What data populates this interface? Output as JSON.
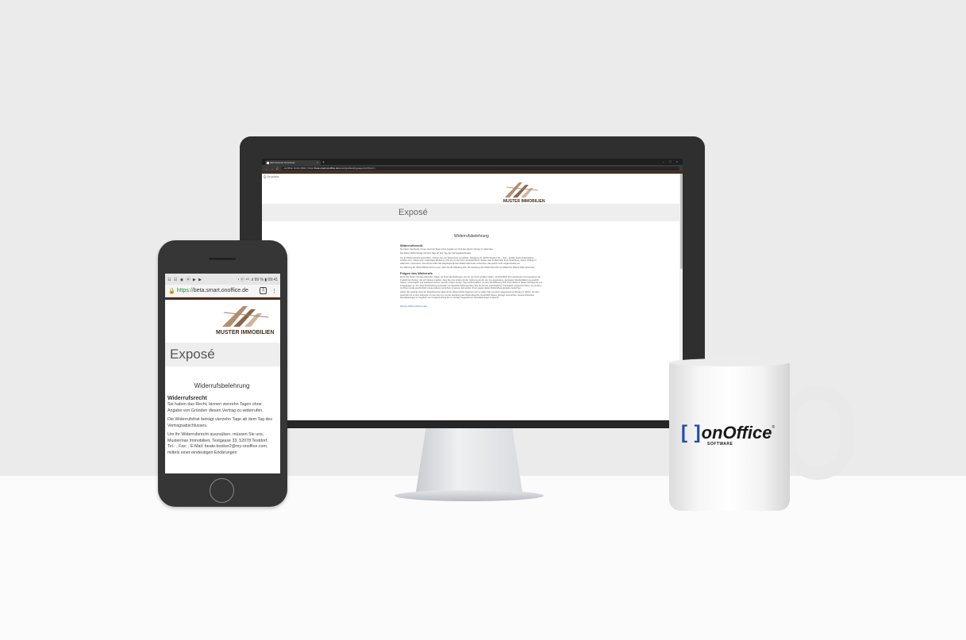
{
  "desktop": {
    "tab_title": "SEO Exposé Download",
    "tab_close": "×",
    "tab_new": "+",
    "window_controls": [
      "–",
      "□",
      "×"
    ],
    "nav": [
      "←",
      "→",
      "C"
    ],
    "url_prefix": "onOffice GmbH [DE] | https://",
    "url_host": "beta.smart.onoffice.de",
    "url_path": "/smart/gui/landingpage.php?form=...",
    "print_label": "Drucken",
    "company_logo_text": "MUSTER IMMOBILIEN",
    "page_title": "Exposé",
    "doc_heading": "Widerrufsbelehrung",
    "sections": [
      {
        "heading": "Widerrufsrecht",
        "paragraphs": [
          "Sie haben das Recht, binnen vierzehn Tagen ohne Angabe von Gründen diesen Vertrag zu widerrufen.",
          "Die Widerrufsfrist beträgt vierzehn Tage ab dem Tag des Vertragsabschlusses.",
          "Um Ihr Widerrufsrecht auszuüben, müssen Sie uns, Mustermax Immobilien, Testgasse 33, 52078 Testdorf, Tel.: , Fax: , E-Mail: beate.booker2@my-onoffice.com, mittels einer eindeutigen Erklärung (z.B. ein mit der Post versandter Brief, Telefax oder E-Mail) über Ihren Entschluss, diesen Vertrag zu widerrufen, informieren. Sie können dafür das beigefügte Muster-Widerrufsformular verwenden, das jedoch nicht vorgeschrieben ist.",
          "Zur Wahrung der Widerrufsfrist reicht es aus, dass Sie die Mitteilung über die Ausübung des Widerrufsrechts vor Ablauf der Widerrufsfrist absenden."
        ]
      },
      {
        "heading": "Folgen des Widerrufs",
        "paragraphs": [
          "Wenn Sie diesen Vertrag widerrufen, haben wir Ihnen alle Zahlungen, die wir von Ihnen erhalten haben, einschließlich der Lieferkosten (mit Ausnahme der zusätzlichen Kosten, die sich daraus ergeben, dass Sie eine andere Art der Lieferung als die von uns angebotene, günstigste Standardlieferung gewählt haben), unverzüglich und spätestens binnen vierzehn Tagen ab dem Tag zurückzuzahlen, an dem die Mitteilung über Ihren Widerruf dieses Vertrags bei uns eingegangen ist. Für diese Rückzahlung verwenden wir dasselbe Zahlungsmittel, das Sie bei der ursprünglichen Transaktion eingesetzt haben, es sei denn, mit Ihnen wurde ausdrücklich etwas anderes vereinbart; in keinem Fall werden Ihnen wegen dieser Rückzahlung Entgelte berechnet.",
          "Haben Sie verlangt, dass die Dienstleistung während der Widerrufsfrist beginnen soll, so haben Sie uns einen angemessenen Betrag zu zahlen, der dem Anteil der bis zu dem Zeitpunkt, zu dem Sie uns von der Ausübung des Widerrufsrechts hinsichtlich dieses Vertrags unterrichten, bereits erbrachten Dienstleistungen im Vergleich zum Gesamtumfang der im Vertrag vorgesehenen Dienstleistungen entspricht."
        ]
      }
    ],
    "form_link": "Muster-Widerrufsformular"
  },
  "mobile": {
    "status_left": "☷ ☷ ◉ ⓦ ▶ ▶",
    "status_right": "◔ ⓝ ⁴ᴳ .ıl 99 % ▮ 09:41",
    "url_scheme": "https://",
    "url_host": "beta.smart.onoffice.de",
    "tab_count": "3",
    "menu_glyph": "⋮",
    "company_logo_text": "MUSTER IMMOBILIEN",
    "page_title": "Exposé",
    "doc_heading": "Widerrufsbelehrung",
    "section_heading": "Widerrufsrecht",
    "paragraphs": [
      "Sie haben das Recht, binnen vierzehn Tagen ohne Angabe von Gründen diesen Vertrag zu widerrufen.",
      "Die Widerrufsfrist beträgt vierzehn Tage ab dem Tag des Vertragsabschlusses.",
      "Um Ihr Widerrufsrecht auszuüben, müssen Sie uns, Mustermax Immobilien, Testgasse 33, 52078 Testdorf, Tel.: , Fax: , E-Mail: beate.booker2@my-onoffice.com, mittels einer eindeutigen Erklärungen"
    ]
  },
  "mug": {
    "bracket": "[ ]",
    "brand": "onOffice",
    "tm": "®",
    "tagline": "SOFTWARE"
  },
  "colors": {
    "brand_blue": "#1d4fa8",
    "brown_accent": "#4a2e1b",
    "link_blue": "#3a78d6"
  }
}
